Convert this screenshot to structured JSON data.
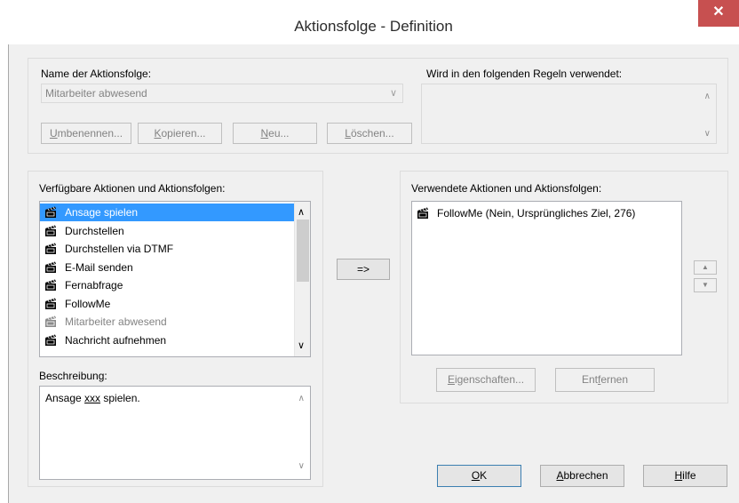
{
  "dialog": {
    "title": "Aktionsfolge - Definition",
    "close_glyph": "✕"
  },
  "sequence": {
    "name_label": "Name der Aktionsfolge:",
    "selected": "Mitarbeiter abwesend",
    "rename": [
      "",
      "U",
      "mbenennen..."
    ],
    "copy": [
      "",
      "K",
      "opieren..."
    ],
    "new": [
      "",
      "N",
      "eu..."
    ],
    "delete": [
      "",
      "L",
      "öschen..."
    ]
  },
  "rules": {
    "label": "Wird in den folgenden Regeln verwendet:"
  },
  "available": {
    "label": "Verfügbare Aktionen und Aktionsfolgen:",
    "items": [
      {
        "label": "Ansage spielen",
        "state": "selected"
      },
      {
        "label": "Durchstellen",
        "state": "normal"
      },
      {
        "label": "Durchstellen via DTMF",
        "state": "normal"
      },
      {
        "label": "E-Mail senden",
        "state": "normal"
      },
      {
        "label": "Fernabfrage",
        "state": "normal"
      },
      {
        "label": "FollowMe",
        "state": "normal"
      },
      {
        "label": "Mitarbeiter abwesend",
        "state": "disabled"
      },
      {
        "label": "Nachricht aufnehmen",
        "state": "normal"
      }
    ]
  },
  "description": {
    "label": "Beschreibung:",
    "text": [
      "Ansage ",
      "xxx",
      " spielen."
    ]
  },
  "add_button": "=>",
  "used": {
    "label": "Verwendete Aktionen und Aktionsfolgen:",
    "items": [
      "FollowMe (Nein, Ursprüngliches Ziel, 276)"
    ],
    "properties": [
      "",
      "E",
      "igenschaften..."
    ],
    "remove": [
      "Ent",
      "f",
      "ernen"
    ]
  },
  "footer": {
    "ok": [
      "",
      "O",
      "K"
    ],
    "cancel": [
      "",
      "A",
      "bbrechen"
    ],
    "help": [
      "",
      "H",
      "ilfe"
    ]
  },
  "icons": {
    "action": "clapperboard-icon",
    "sequence": "sequence-icon"
  }
}
